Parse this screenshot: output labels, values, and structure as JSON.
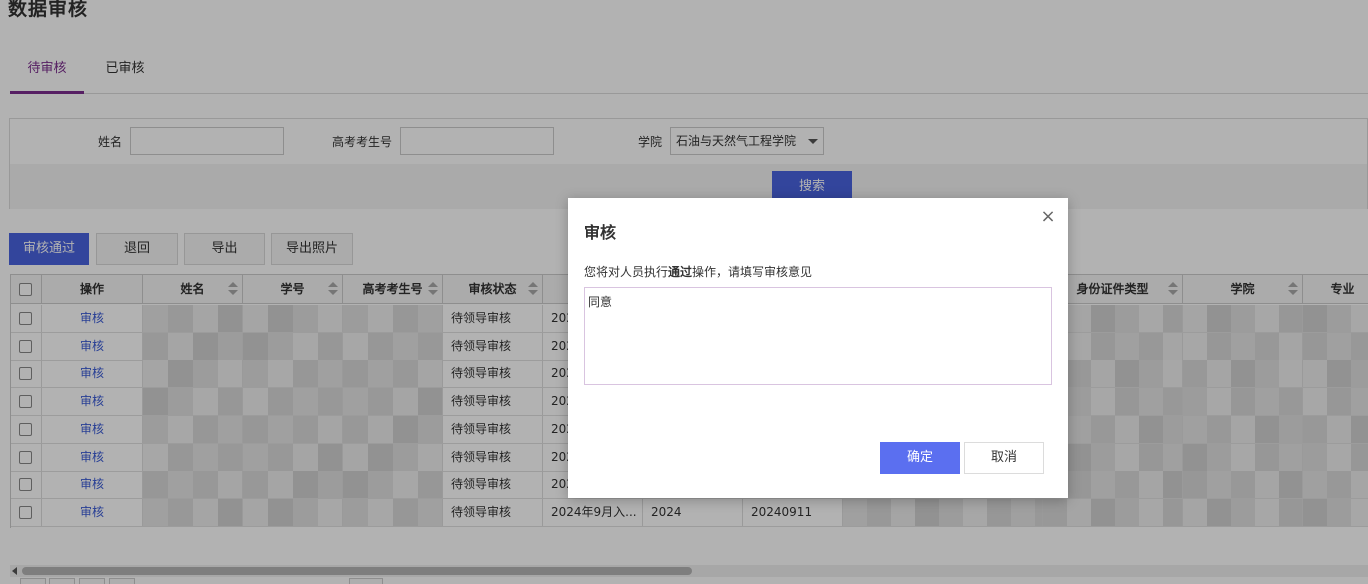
{
  "page": {
    "title": "数据审核"
  },
  "tabs": [
    {
      "label": "待审核",
      "active": true
    },
    {
      "label": "已审核",
      "active": false
    }
  ],
  "filter": {
    "name_label": "姓名",
    "name_value": "",
    "exam_no_label": "高考考生号",
    "exam_no_value": "",
    "college_label": "学院",
    "college_value": "石油与天然气工程学院",
    "search_label": "搜索"
  },
  "toolbar": {
    "approve_label": "审核通过",
    "reject_label": "退回",
    "export_label": "导出",
    "export_photo_label": "导出照片"
  },
  "table": {
    "columns": [
      "操作",
      "姓名",
      "学号",
      "高考考生号",
      "审核状态",
      "",
      "",
      "",
      "",
      "身份证件类型",
      "学院",
      "专业"
    ],
    "rows": [
      {
        "action": "审核",
        "status": "待领导审核",
        "col6": "202",
        "col7": "",
        "col8": ""
      },
      {
        "action": "审核",
        "status": "待领导审核",
        "col6": "202",
        "col7": "",
        "col8": ""
      },
      {
        "action": "审核",
        "status": "待领导审核",
        "col6": "202",
        "col7": "",
        "col8": ""
      },
      {
        "action": "审核",
        "status": "待领导审核",
        "col6": "202",
        "col7": "",
        "col8": ""
      },
      {
        "action": "审核",
        "status": "待领导审核",
        "col6": "202",
        "col7": "",
        "col8": ""
      },
      {
        "action": "审核",
        "status": "待领导审核",
        "col6": "202",
        "col7": "",
        "col8": ""
      },
      {
        "action": "审核",
        "status": "待领导审核",
        "col6": "202",
        "col7": "",
        "col8": ""
      },
      {
        "action": "审核",
        "status": "待领导审核",
        "col6": "2024年9月入...",
        "col7": "2024",
        "col8": "20240911"
      }
    ]
  },
  "dialog": {
    "title": "审核",
    "close": "×",
    "message_prefix": "您将对人员执行",
    "message_action": "通过",
    "message_suffix": "操作，请填写审核意见",
    "opinion_value": "同意",
    "confirm_label": "确定",
    "cancel_label": "取消"
  },
  "colors": {
    "accent": "#7b2d8e",
    "primary_button": "#4a63e0",
    "link": "#3a5bd6"
  }
}
